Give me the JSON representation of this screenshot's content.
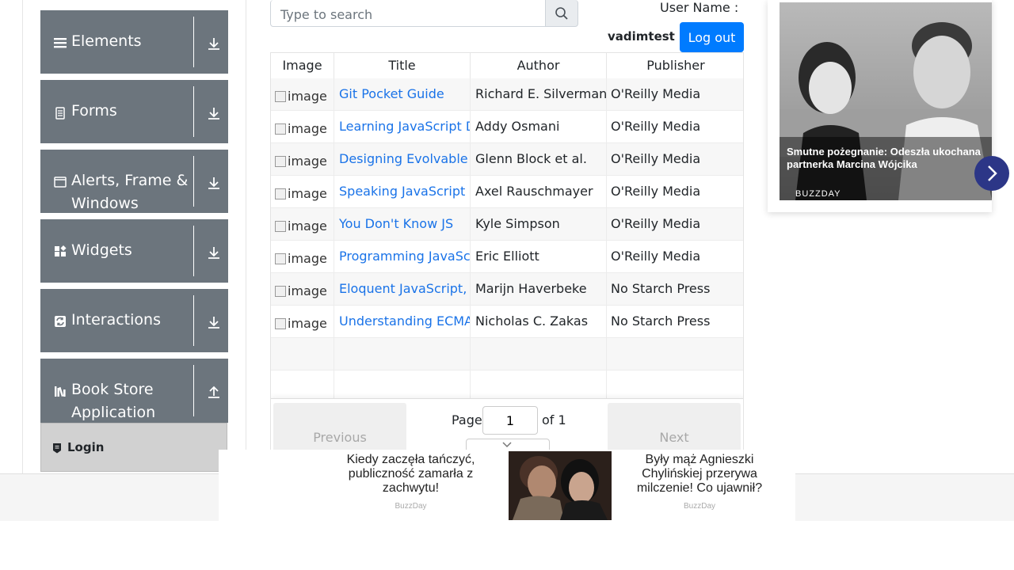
{
  "sidebar": {
    "groups": [
      {
        "label": "Elements",
        "icon": "hamburger-icon",
        "arrow": "download-arrow-icon"
      },
      {
        "label": "Forms",
        "icon": "document-icon",
        "arrow": "download-arrow-icon"
      },
      {
        "label": "Alerts, Frame & Windows",
        "label_line1": "Alerts, Frame &",
        "label_line2": "Windows",
        "icon": "window-icon",
        "arrow": "download-arrow-icon"
      },
      {
        "label": "Widgets",
        "icon": "widgets-icon",
        "arrow": "download-arrow-icon"
      },
      {
        "label": "Interactions",
        "icon": "refresh-icon",
        "arrow": "download-arrow-icon"
      },
      {
        "label": "Book Store Application",
        "label_line1": "Book Store",
        "label_line2": "Application",
        "icon": "books-icon",
        "arrow": "upload-arrow-icon"
      }
    ],
    "active_item": {
      "label": "Login",
      "icon": "login-icon"
    }
  },
  "search": {
    "placeholder": "Type to search",
    "value": ""
  },
  "user": {
    "label": "User Name :",
    "value": "vadimtest",
    "logout_label": "Log out"
  },
  "table": {
    "columns": [
      "Image",
      "Title",
      "Author",
      "Publisher"
    ],
    "image_alt": "image",
    "rows": [
      {
        "title": "Git Pocket Guide",
        "author": "Richard E. Silverman",
        "publisher": "O'Reilly Media"
      },
      {
        "title": "Learning JavaScript Des",
        "author": "Addy Osmani",
        "publisher": "O'Reilly Media"
      },
      {
        "title": "Designing Evolvable We",
        "author": "Glenn Block et al.",
        "publisher": "O'Reilly Media"
      },
      {
        "title": "Speaking JavaScript",
        "author": "Axel Rauschmayer",
        "publisher": "O'Reilly Media"
      },
      {
        "title": "You Don't Know JS",
        "author": "Kyle Simpson",
        "publisher": "O'Reilly Media"
      },
      {
        "title": "Programming JavaScrip",
        "author": "Eric Elliott",
        "publisher": "O'Reilly Media"
      },
      {
        "title": "Eloquent JavaScript, Sec",
        "author": "Marijn Haverbeke",
        "publisher": "No Starch Press"
      },
      {
        "title": "Understanding ECMASc",
        "author": "Nicholas C. Zakas",
        "publisher": "No Starch Press"
      }
    ],
    "empty_rows": 2
  },
  "pagination": {
    "previous_label": "Previous",
    "next_label": "Next",
    "page_label": "Page",
    "page_value": "1",
    "of_label": "of 1"
  },
  "ad_right": {
    "caption": "Smutne pożegnanie: Odeszła ukochana partnerka Marcina Wójcika",
    "source": "BUZZDAY"
  },
  "ad_bottom": {
    "left_text": "Kiedy zaczęła tańczyć, publiczność zamarła z zachwytu!",
    "left_source": "BuzzDay",
    "right_text": "Były mąż Agnieszki Chylińskiej przerywa milczenie! Co ujawnił?",
    "right_source": "BuzzDay"
  },
  "colors": {
    "sidebar_group_bg": "#6c757d",
    "link": "#1a73e8",
    "primary_button": "#007bff",
    "ad_next_button": "#2c3687"
  }
}
